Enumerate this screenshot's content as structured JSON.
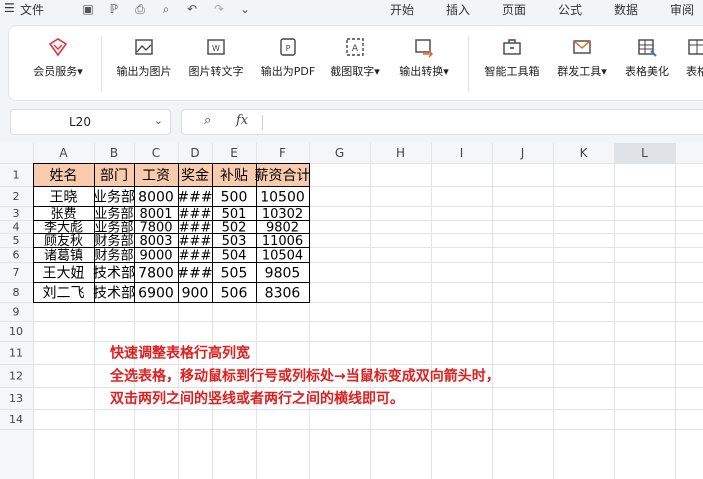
{
  "menubar": {
    "file_label": "文件",
    "tabs": [
      "开始",
      "插入",
      "页面",
      "公式",
      "数据",
      "审阅"
    ]
  },
  "quick_access": [
    "save-icon",
    "format-painter-icon",
    "print-icon",
    "print-preview-icon",
    "undo-icon",
    "redo-icon",
    "chevron-down-icon"
  ],
  "ribbon": {
    "items": [
      {
        "label": "会员服务",
        "icon": "member-icon",
        "dropdown": true
      },
      {
        "label": "输出为图片",
        "icon": "image-export-icon",
        "dropdown": false
      },
      {
        "label": "图片转文字",
        "icon": "image-to-text-icon",
        "dropdown": false
      },
      {
        "label": "输出为PDF",
        "icon": "pdf-export-icon",
        "dropdown": false
      },
      {
        "label": "截图取字",
        "icon": "screenshot-text-icon",
        "dropdown": true
      },
      {
        "label": "输出转换",
        "icon": "convert-icon",
        "dropdown": true
      },
      {
        "label": "智能工具箱",
        "icon": "toolbox-icon",
        "dropdown": false
      },
      {
        "label": "群发工具",
        "icon": "mail-icon",
        "dropdown": true
      },
      {
        "label": "表格美化",
        "icon": "table-beautify-icon",
        "dropdown": false
      },
      {
        "label": "表格",
        "icon": "table-icon",
        "dropdown": false
      }
    ]
  },
  "namebox": {
    "value": "L20"
  },
  "formula": {
    "fx_label": "fx",
    "content": ""
  },
  "sheet": {
    "columns": [
      "A",
      "B",
      "C",
      "D",
      "E",
      "F",
      "G",
      "H",
      "I",
      "J",
      "K",
      "L"
    ],
    "selected_column": "L",
    "rows": [
      "1",
      "2",
      "3",
      "4",
      "5",
      "6",
      "7",
      "8",
      "9",
      "10",
      "11",
      "12",
      "13",
      "14"
    ],
    "table": [
      [
        "姓名",
        "部门",
        "工资",
        "奖金",
        "补贴",
        "薪资合计"
      ],
      [
        "王晓",
        "业务部",
        "8000",
        "###",
        "500",
        "10500"
      ],
      [
        "张费",
        "业务部",
        "8001",
        "###",
        "501",
        "10302"
      ],
      [
        "李大彪",
        "业务部",
        "7800",
        "###",
        "502",
        "9802"
      ],
      [
        "顾友秋",
        "财务部",
        "8003",
        "###",
        "503",
        "11006"
      ],
      [
        "诸葛镇",
        "财务部",
        "9000",
        "###",
        "504",
        "10504"
      ],
      [
        "王大妞",
        "技术部",
        "7800",
        "###",
        "505",
        "9805"
      ],
      [
        "刘二飞",
        "技术部",
        "6900",
        "900",
        "506",
        "8306"
      ]
    ],
    "header_fill": "#f8cbad",
    "notes": [
      "快速调整表格行高列宽",
      "全选表格，移动鼠标到行号或列标处→当鼠标变成双向箭头时，",
      "双击两列之间的竖线或者两行之间的横线即可。"
    ],
    "note_color": "#e02020"
  }
}
